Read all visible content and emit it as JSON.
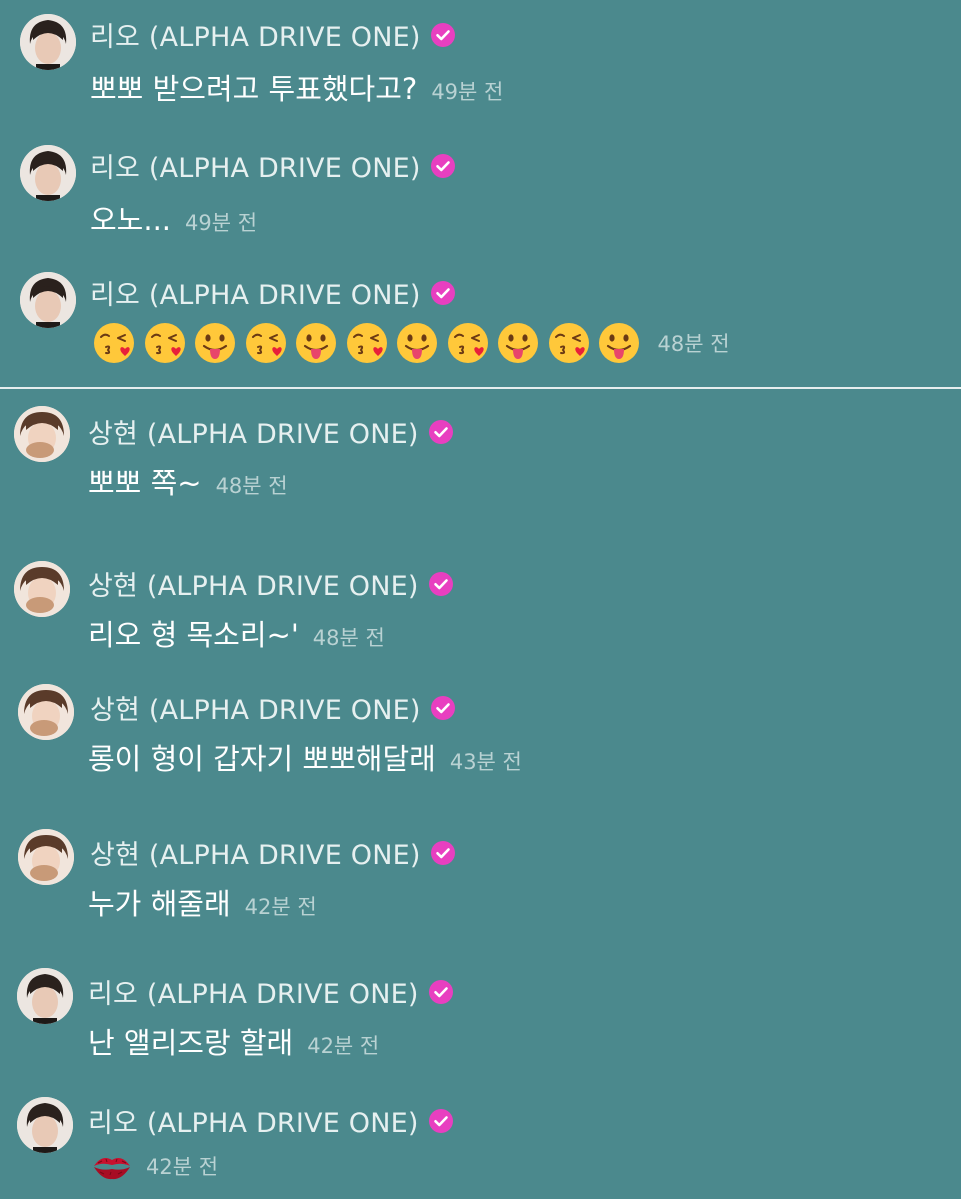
{
  "messages": [
    {
      "name": "리오 (ALPHA DRIVE ONE)",
      "text": "뽀뽀 받으려고 투표했다고?",
      "time": "49분 전"
    },
    {
      "name": "리오 (ALPHA DRIVE ONE)",
      "text": "오노...",
      "time": "49분 전"
    },
    {
      "name": "리오 (ALPHA DRIVE ONE)",
      "emojis": [
        "kissing-heart-emoji",
        "kissing-heart-emoji",
        "tongue-out-emoji",
        "kissing-heart-emoji",
        "tongue-out-emoji",
        "kissing-heart-emoji",
        "tongue-out-emoji",
        "kissing-heart-emoji",
        "tongue-out-emoji",
        "kissing-heart-emoji",
        "tongue-out-emoji"
      ],
      "time": "48분 전"
    },
    {
      "name": "상현 (ALPHA DRIVE ONE)",
      "text": "뽀뽀 쪽~",
      "time": "48분 전"
    },
    {
      "name": "상현 (ALPHA DRIVE ONE)",
      "text": "리오 형 목소리~'",
      "time": "48분 전"
    },
    {
      "name": "상현 (ALPHA DRIVE ONE)",
      "text": "롱이 형이 갑자기 뽀뽀해달래",
      "time": "43분 전"
    },
    {
      "name": "상현 (ALPHA DRIVE ONE)",
      "text": "누가 해줄래",
      "time": "42분 전"
    },
    {
      "name": "리오 (ALPHA DRIVE ONE)",
      "text": "난 앨리즈랑 할래",
      "time": "42분 전"
    },
    {
      "name": "리오 (ALPHA DRIVE ONE)",
      "emojis": [
        "kiss-mark-emoji"
      ],
      "time": "42분 전"
    }
  ],
  "colors": {
    "background": "#4b898d",
    "badge": "#e83fc0",
    "time": "#b9d2d3"
  }
}
